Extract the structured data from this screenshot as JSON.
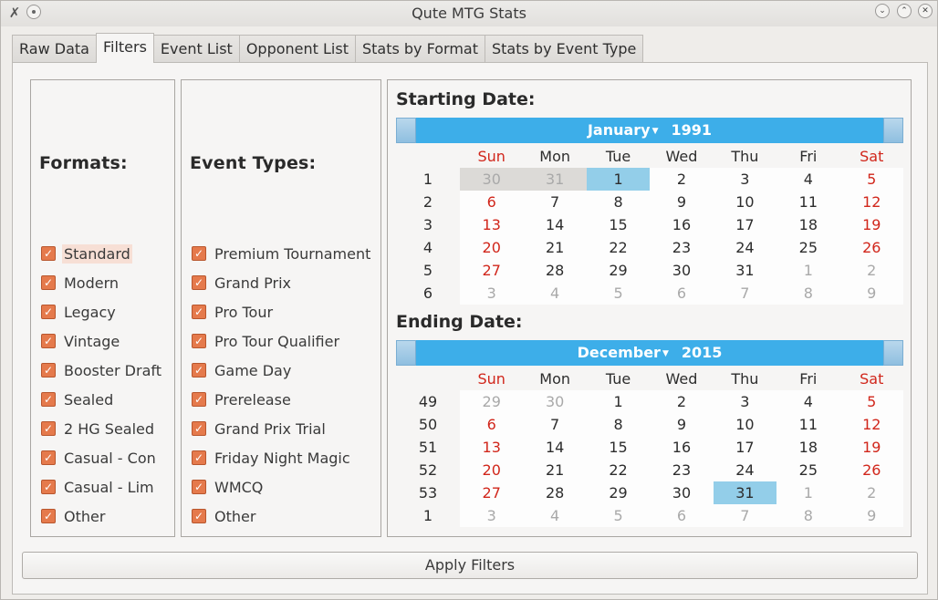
{
  "window": {
    "title": "Qute MTG Stats"
  },
  "tabs": [
    "Raw Data",
    "Filters",
    "Event List",
    "Opponent List",
    "Stats by Format",
    "Stats by Event Type"
  ],
  "formats": {
    "title": "Formats:",
    "items": [
      "Standard",
      "Modern",
      "Legacy",
      "Vintage",
      "Booster Draft",
      "Sealed",
      "2 HG Sealed",
      "Casual - Con",
      "Casual - Lim",
      "Other"
    ]
  },
  "event_types": {
    "title": "Event Types:",
    "items": [
      "Premium Tournament",
      "Grand Prix",
      "Pro Tour",
      "Pro Tour Qualifier",
      "Game Day",
      "Prerelease",
      "Grand Prix Trial",
      "Friday Night Magic",
      "WMCQ",
      "Other"
    ]
  },
  "checkbox_mark": "✓",
  "start": {
    "title": "Starting Date:",
    "month": "January",
    "year": "1991",
    "weekdays": [
      "Sun",
      "Mon",
      "Tue",
      "Wed",
      "Thu",
      "Fri",
      "Sat"
    ],
    "weeks": [
      "1",
      "2",
      "3",
      "4",
      "5",
      "6"
    ],
    "days": [
      [
        "30",
        "31",
        "1",
        "2",
        "3",
        "4",
        "5"
      ],
      [
        "6",
        "7",
        "8",
        "9",
        "10",
        "11",
        "12"
      ],
      [
        "13",
        "14",
        "15",
        "16",
        "17",
        "18",
        "19"
      ],
      [
        "20",
        "21",
        "22",
        "23",
        "24",
        "25",
        "26"
      ],
      [
        "27",
        "28",
        "29",
        "30",
        "31",
        "1",
        "2"
      ],
      [
        "3",
        "4",
        "5",
        "6",
        "7",
        "8",
        "9"
      ]
    ]
  },
  "end": {
    "title": "Ending Date:",
    "month": "December",
    "year": "2015",
    "weekdays": [
      "Sun",
      "Mon",
      "Tue",
      "Wed",
      "Thu",
      "Fri",
      "Sat"
    ],
    "weeks": [
      "49",
      "50",
      "51",
      "52",
      "53",
      "1"
    ],
    "days": [
      [
        "29",
        "30",
        "1",
        "2",
        "3",
        "4",
        "5"
      ],
      [
        "6",
        "7",
        "8",
        "9",
        "10",
        "11",
        "12"
      ],
      [
        "13",
        "14",
        "15",
        "16",
        "17",
        "18",
        "19"
      ],
      [
        "20",
        "21",
        "22",
        "23",
        "24",
        "25",
        "26"
      ],
      [
        "27",
        "28",
        "29",
        "30",
        "31",
        "1",
        "2"
      ],
      [
        "3",
        "4",
        "5",
        "6",
        "7",
        "8",
        "9"
      ]
    ]
  },
  "apply_button": "Apply Filters",
  "colors": {
    "accent": "#3daee9",
    "checkbox": "#e57a4c",
    "weekend": "#d1261b",
    "selected_day": "#93cee9"
  }
}
